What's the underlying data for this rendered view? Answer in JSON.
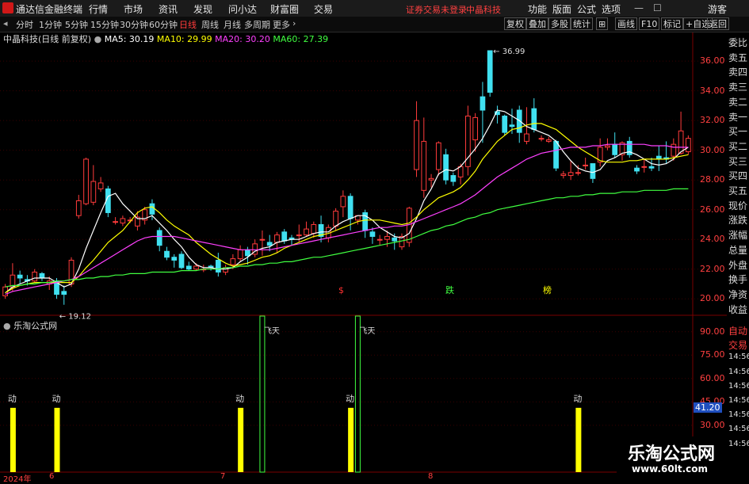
{
  "app": {
    "title": "通达信金融终端",
    "menu": [
      "行情",
      "市场",
      "资讯",
      "发现",
      "问小达",
      "财富圈",
      "交易"
    ],
    "account": [
      "证券交易未登录",
      "中晶科技"
    ],
    "right_menu": [
      "功能",
      "版面",
      "公式",
      "选项"
    ],
    "guest": "游客"
  },
  "periods": [
    "分时",
    "1分钟",
    "5分钟",
    "15分钟",
    "30分钟",
    "60分钟",
    "日线",
    "周线",
    "月线",
    "多周期",
    "更多"
  ],
  "active_period": "日线",
  "toolbar": [
    "复权",
    "叠加",
    "多股",
    "统计",
    "画线",
    "F10",
    "标记",
    "+自选",
    "返回"
  ],
  "stock": {
    "name": "中晶科技",
    "mode": "(日线 前复权)"
  },
  "ma": [
    {
      "label": "MA5: 30.19",
      "color": "#ffffff"
    },
    {
      "label": "MA10: 29.99",
      "color": "#ffff00"
    },
    {
      "label": "MA20: 30.20",
      "color": "#ff40ff"
    },
    {
      "label": "MA60: 27.39",
      "color": "#40ff40"
    }
  ],
  "price_axis": [
    "36.00",
    "34.00",
    "32.00",
    "30.00",
    "28.00",
    "26.00",
    "24.00",
    "22.00",
    "20.00"
  ],
  "high_label": "36.99",
  "low_label": "19.12",
  "signals": [
    {
      "text": "$",
      "color": "#ff3030"
    },
    {
      "text": "跌",
      "color": "#40ff40"
    },
    {
      "text": "榜",
      "color": "#ffff00"
    }
  ],
  "sub_title": "乐淘公式网",
  "sub_axis": [
    "90.00",
    "75.00",
    "60.00",
    "45.00",
    "30.00"
  ],
  "sub_value": "41.20",
  "sub_marks": {
    "dong": "动",
    "feitian": "飞天"
  },
  "dates": [
    "2024年",
    "6",
    "7",
    "8"
  ],
  "sidebar": [
    "委比",
    "卖五",
    "卖四",
    "卖三",
    "卖二",
    "卖一",
    "买一",
    "买二",
    "买三",
    "买四",
    "买五",
    "现价",
    "涨跌",
    "涨幅",
    "总量",
    "外盘",
    "换手",
    "净资",
    "收益",
    "自动",
    "交易",
    "14:56",
    "14:56",
    "14:56",
    "14:56",
    "14:56",
    "14:56",
    "14:56"
  ],
  "watermark": {
    "name": "乐淘公式网",
    "url": "www.60lt.com"
  },
  "chart_data": {
    "type": "candlestick",
    "ylim": [
      19,
      37.5
    ],
    "candles": [
      [
        20.2,
        20.8,
        20.0,
        21.0
      ],
      [
        20.8,
        21.6,
        20.5,
        22.4
      ],
      [
        21.6,
        21.4,
        21.0,
        21.9
      ],
      [
        21.3,
        21.2,
        20.9,
        21.6
      ],
      [
        21.2,
        21.8,
        21.1,
        22.0
      ],
      [
        21.7,
        21.4,
        21.2,
        21.8
      ],
      [
        21.0,
        21.2,
        20.6,
        21.5
      ],
      [
        21.2,
        20.3,
        20.0,
        21.4
      ],
      [
        20.5,
        20.3,
        19.6,
        20.9
      ],
      [
        21.0,
        22.6,
        20.8,
        22.8
      ],
      [
        25.6,
        26.6,
        25.4,
        27.0
      ],
      [
        26.4,
        29.4,
        26.3,
        29.5
      ],
      [
        26.5,
        27.9,
        26.3,
        29.0
      ],
      [
        27.4,
        27.8,
        27.2,
        28.2
      ],
      [
        27.4,
        25.8,
        25.5,
        27.6
      ],
      [
        25.2,
        25.2,
        25.0,
        25.5
      ],
      [
        25.1,
        25.4,
        24.9,
        25.6
      ],
      [
        25.3,
        25.3,
        25.1,
        25.5
      ],
      [
        24.9,
        25.5,
        24.6,
        25.9
      ],
      [
        25.3,
        26.0,
        25.0,
        26.2
      ],
      [
        26.4,
        25.7,
        25.3,
        26.7
      ],
      [
        24.6,
        23.6,
        23.2,
        24.8
      ],
      [
        23.2,
        22.8,
        22.6,
        23.5
      ],
      [
        22.8,
        22.6,
        22.1,
        23.0
      ],
      [
        23.0,
        22.1,
        22.0,
        23.2
      ],
      [
        22.2,
        22.0,
        21.9,
        22.5
      ],
      [
        22.0,
        22.2,
        21.9,
        22.4
      ],
      [
        22.0,
        22.0,
        21.8,
        22.3
      ],
      [
        22.2,
        22.1,
        21.9,
        22.3
      ],
      [
        22.6,
        21.8,
        21.5,
        23.1
      ],
      [
        21.8,
        22.1,
        21.6,
        22.3
      ],
      [
        22.3,
        22.7,
        22.0,
        23.0
      ],
      [
        22.7,
        23.3,
        22.5,
        23.6
      ],
      [
        23.3,
        22.9,
        22.3,
        23.5
      ],
      [
        23.0,
        23.7,
        22.8,
        24.0
      ],
      [
        24.0,
        24.0,
        22.9,
        24.6
      ],
      [
        23.8,
        23.6,
        23.2,
        24.3
      ],
      [
        23.8,
        24.3,
        23.1,
        24.5
      ],
      [
        24.5,
        23.9,
        23.7,
        24.7
      ],
      [
        24.1,
        24.0,
        23.6,
        24.3
      ],
      [
        24.3,
        24.3,
        23.8,
        25.0
      ],
      [
        24.3,
        24.7,
        24.2,
        25.2
      ],
      [
        24.4,
        25.0,
        24.1,
        25.2
      ],
      [
        25.0,
        24.2,
        23.8,
        25.6
      ],
      [
        24.1,
        24.8,
        23.8,
        25.0
      ],
      [
        24.9,
        25.9,
        24.6,
        26.1
      ],
      [
        26.2,
        26.9,
        25.5,
        27.3
      ],
      [
        26.9,
        25.4,
        24.6,
        27.1
      ],
      [
        25.3,
        25.6,
        25.0,
        25.6
      ],
      [
        25.8,
        24.6,
        24.1,
        26.0
      ],
      [
        24.5,
        24.2,
        23.7,
        24.8
      ],
      [
        24.0,
        24.0,
        23.6,
        24.3
      ],
      [
        24.0,
        24.2,
        23.5,
        24.6
      ],
      [
        24.1,
        23.9,
        23.3,
        24.4
      ],
      [
        23.5,
        24.2,
        23.3,
        24.4
      ],
      [
        23.8,
        26.1,
        23.5,
        26.2
      ],
      [
        28.7,
        32.0,
        28.2,
        33.3
      ],
      [
        27.3,
        30.6,
        26.8,
        32.2
      ],
      [
        28.0,
        28.1,
        27.5,
        28.4
      ],
      [
        28.7,
        30.5,
        28.3,
        30.6
      ],
      [
        29.7,
        28.0,
        27.7,
        30.1
      ],
      [
        28.3,
        27.9,
        27.6,
        28.5
      ],
      [
        28.2,
        28.9,
        27.7,
        29.1
      ],
      [
        28.9,
        32.3,
        28.3,
        33.0
      ],
      [
        30.7,
        32.2,
        29.9,
        32.5
      ],
      [
        33.6,
        32.7,
        30.5,
        34.6
      ],
      [
        36.7,
        33.9,
        33.6,
        36.7
      ],
      [
        32.6,
        32.4,
        31.8,
        33.0
      ],
      [
        32.3,
        31.2,
        31.0,
        32.4
      ],
      [
        31.7,
        31.6,
        31.1,
        32.8
      ],
      [
        32.7,
        31.2,
        30.5,
        33.0
      ],
      [
        30.6,
        31.1,
        30.4,
        32.9
      ],
      [
        32.8,
        31.4,
        31.2,
        33.5
      ],
      [
        30.8,
        30.8,
        30.6,
        31.0
      ],
      [
        30.6,
        30.7,
        30.5,
        30.9
      ],
      [
        30.6,
        28.8,
        28.6,
        30.7
      ],
      [
        28.3,
        28.4,
        28.1,
        28.6
      ],
      [
        28.3,
        28.5,
        28.0,
        29.3
      ],
      [
        28.5,
        28.5,
        28.3,
        29.0
      ],
      [
        29.0,
        29.0,
        28.7,
        29.5
      ],
      [
        29.1,
        28.1,
        27.8,
        29.1
      ],
      [
        29.2,
        30.2,
        28.9,
        30.8
      ],
      [
        30.2,
        30.3,
        30.0,
        30.8
      ],
      [
        30.4,
        29.7,
        29.5,
        31.2
      ],
      [
        29.7,
        30.5,
        29.3,
        30.6
      ],
      [
        30.6,
        29.7,
        29.5,
        30.9
      ],
      [
        28.8,
        28.6,
        28.4,
        29.0
      ],
      [
        28.9,
        28.9,
        28.5,
        29.4
      ],
      [
        28.9,
        28.8,
        28.6,
        29.5
      ],
      [
        29.6,
        29.4,
        28.6,
        30.3
      ],
      [
        29.5,
        29.4,
        29.1,
        30.6
      ],
      [
        29.6,
        30.4,
        29.3,
        30.8
      ],
      [
        29.8,
        31.3,
        29.7,
        32.6
      ],
      [
        29.9,
        30.8,
        29.7,
        31.0
      ]
    ],
    "ma5": [
      20.4,
      20.8,
      21.0,
      21.2,
      21.4,
      21.4,
      21.4,
      21.1,
      20.8,
      21.0,
      22.0,
      23.4,
      24.6,
      25.8,
      26.9,
      27.1,
      26.4,
      25.9,
      25.4,
      25.4,
      25.6,
      25.1,
      24.6,
      24.0,
      23.5,
      22.8,
      22.3,
      22.1,
      22.1,
      22.0,
      22.0,
      22.1,
      22.5,
      22.8,
      23.2,
      23.4,
      23.5,
      23.8,
      23.9,
      24.0,
      24.0,
      24.2,
      24.4,
      24.5,
      24.5,
      24.9,
      25.2,
      25.4,
      25.6,
      25.6,
      25.3,
      24.8,
      24.5,
      24.2,
      24.1,
      24.4,
      25.4,
      26.6,
      27.4,
      28.4,
      28.7,
      28.6,
      28.9,
      29.5,
      30.1,
      30.8,
      31.7,
      32.7,
      32.6,
      32.3,
      32.0,
      31.6,
      31.4,
      31.2,
      31.0,
      30.6,
      29.9,
      29.3,
      28.8,
      28.6,
      28.5,
      28.7,
      29.3,
      29.5,
      29.8,
      29.9,
      29.7,
      29.4,
      29.1,
      29.0,
      29.1,
      29.4,
      29.9,
      30.2
    ],
    "ma10": [
      20.4,
      20.7,
      20.9,
      21.0,
      21.1,
      21.1,
      21.1,
      21.1,
      21.1,
      21.1,
      21.5,
      22.1,
      22.6,
      23.2,
      23.8,
      24.2,
      24.6,
      25.2,
      25.8,
      26.1,
      26.2,
      25.8,
      25.3,
      24.9,
      24.6,
      24.3,
      23.8,
      23.4,
      23.0,
      22.7,
      22.4,
      22.2,
      22.3,
      22.4,
      22.6,
      22.8,
      22.9,
      23.1,
      23.4,
      23.6,
      23.8,
      24.0,
      24.2,
      24.3,
      24.4,
      24.6,
      24.8,
      25.0,
      25.2,
      25.3,
      25.3,
      25.3,
      25.2,
      25.1,
      25.0,
      25.1,
      25.5,
      26.0,
      26.4,
      26.8,
      27.0,
      27.2,
      27.5,
      28.0,
      28.6,
      29.4,
      30.0,
      30.6,
      31.0,
      31.4,
      31.5,
      31.7,
      31.8,
      31.8,
      31.6,
      31.4,
      31.0,
      30.6,
      30.2,
      29.9,
      29.6,
      29.3,
      29.2,
      29.2,
      29.2,
      29.3,
      29.3,
      29.4,
      29.4,
      29.4,
      29.4,
      29.5,
      29.6,
      29.7
    ],
    "ma20": [
      20.3,
      20.5,
      20.6,
      20.7,
      20.8,
      20.9,
      21.0,
      21.1,
      21.2,
      21.3,
      21.5,
      21.8,
      22.1,
      22.4,
      22.7,
      23.0,
      23.3,
      23.6,
      23.9,
      24.1,
      24.2,
      24.2,
      24.2,
      24.2,
      24.1,
      24.0,
      23.9,
      23.8,
      23.7,
      23.6,
      23.5,
      23.4,
      23.3,
      23.3,
      23.3,
      23.3,
      23.3,
      23.4,
      23.5,
      23.6,
      23.7,
      23.8,
      23.9,
      24.0,
      24.1,
      24.2,
      24.3,
      24.4,
      24.5,
      24.6,
      24.7,
      24.8,
      24.8,
      24.9,
      24.9,
      25.0,
      25.2,
      25.4,
      25.6,
      25.8,
      26.0,
      26.2,
      26.4,
      26.7,
      27.0,
      27.4,
      27.8,
      28.2,
      28.5,
      28.8,
      29.1,
      29.4,
      29.6,
      29.8,
      29.9,
      30.0,
      30.1,
      30.2,
      30.2,
      30.2,
      30.3,
      30.3,
      30.4,
      30.4,
      30.4,
      30.4,
      30.4,
      30.4,
      30.3,
      30.3,
      30.3,
      30.2,
      30.2,
      30.2
    ],
    "ma60": [
      20.8,
      20.9,
      20.9,
      21.0,
      21.0,
      21.1,
      21.1,
      21.2,
      21.2,
      21.3,
      21.3,
      21.4,
      21.4,
      21.5,
      21.5,
      21.6,
      21.6,
      21.7,
      21.7,
      21.7,
      21.8,
      21.8,
      21.8,
      21.8,
      21.9,
      21.9,
      21.9,
      22.0,
      22.0,
      22.0,
      22.1,
      22.1,
      22.2,
      22.2,
      22.3,
      22.3,
      22.4,
      22.4,
      22.5,
      22.5,
      22.6,
      22.7,
      22.8,
      22.8,
      22.9,
      23.0,
      23.1,
      23.2,
      23.3,
      23.4,
      23.5,
      23.6,
      23.7,
      23.8,
      23.9,
      24.0,
      24.2,
      24.4,
      24.6,
      24.7,
      24.9,
      25.0,
      25.2,
      25.4,
      25.5,
      25.7,
      25.8,
      26.0,
      26.1,
      26.2,
      26.3,
      26.4,
      26.5,
      26.6,
      26.7,
      26.8,
      26.8,
      26.9,
      26.9,
      27.0,
      27.0,
      27.1,
      27.1,
      27.1,
      27.2,
      27.2,
      27.2,
      27.3,
      27.3,
      27.3,
      27.3,
      27.4,
      27.4,
      27.4
    ],
    "sub_bars": [
      {
        "index": 1,
        "value": 41.2,
        "label": "动",
        "kind": "yellow"
      },
      {
        "index": 7,
        "value": 41.2,
        "label": "动",
        "kind": "yellow"
      },
      {
        "index": 32,
        "value": 41.2,
        "label": "动",
        "kind": "yellow"
      },
      {
        "index": 35,
        "value": 100,
        "label": "飞天",
        "kind": "green"
      },
      {
        "index": 47,
        "value": 41.2,
        "label": "动",
        "kind": "yellow"
      },
      {
        "index": 48,
        "value": 100,
        "label": "飞天",
        "kind": "green"
      },
      {
        "index": 78,
        "value": 41.2,
        "label": "动",
        "kind": "yellow"
      }
    ],
    "sub_ylim": [
      0,
      100
    ]
  }
}
